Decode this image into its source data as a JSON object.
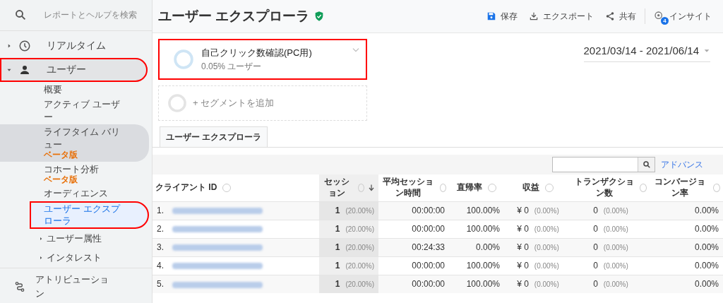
{
  "sidebar": {
    "search": {
      "placeholder": "レポートとヘルプを検索"
    },
    "nav": [
      {
        "kind": "clock",
        "label": "リアルタイム",
        "expanded": false,
        "annotated": false
      },
      {
        "kind": "person",
        "label": "ユーザー",
        "expanded": true,
        "annotated": true,
        "children": [
          {
            "label": "概要",
            "selected": false,
            "hovered": false,
            "annotated": false,
            "collapsible": false
          },
          {
            "label": "アクティブ ユーザー",
            "selected": false,
            "hovered": false,
            "annotated": false,
            "collapsible": false
          },
          {
            "label": "ライフタイム バリュー",
            "badge": "ベータ版",
            "selected": false,
            "hovered": true,
            "annotated": false,
            "collapsible": false
          },
          {
            "label": "コホート分析",
            "badge": "ベータ版",
            "selected": false,
            "hovered": false,
            "annotated": false,
            "collapsible": false
          },
          {
            "label": "オーディエンス",
            "selected": false,
            "hovered": false,
            "annotated": false,
            "collapsible": false
          },
          {
            "label": "ユーザー エクスプローラ",
            "selected": true,
            "hovered": false,
            "annotated": true,
            "collapsible": false
          },
          {
            "label": "ユーザー属性",
            "selected": false,
            "hovered": false,
            "annotated": false,
            "collapsible": true
          },
          {
            "label": "インタレスト",
            "selected": false,
            "hovered": false,
            "annotated": false,
            "collapsible": true
          }
        ]
      }
    ],
    "bottom": {
      "label": "アトリビューション"
    }
  },
  "header": {
    "title": "ユーザー エクスプローラ",
    "verified": true,
    "actions": [
      {
        "kind": "save",
        "label": "保存"
      },
      {
        "kind": "export",
        "label": "エクスポート"
      },
      {
        "kind": "share",
        "label": "共有"
      },
      {
        "kind": "insight",
        "label": "インサイト",
        "badge": "4"
      }
    ]
  },
  "segment": {
    "name": "自己クリック数確認(PC用)",
    "detail": "0.05% ユーザー",
    "annotated": true
  },
  "add_segment": "+ セグメントを追加",
  "date_range": "2021/03/14 - 2021/06/14",
  "tabs": [
    {
      "label": "ユーザー エクスプローラ",
      "selected": true
    }
  ],
  "table": {
    "advanced_link": "アドバンス",
    "columns": [
      {
        "label": "クライアント ID",
        "sorted": false
      },
      {
        "label": "セッション",
        "sorted": true
      },
      {
        "label": "平均セッション時間",
        "sorted": false
      },
      {
        "label": "直帰率",
        "sorted": false
      },
      {
        "label": "収益",
        "sorted": false
      },
      {
        "label": "トランザクション数",
        "sorted": false
      },
      {
        "label": "コンバージョン率",
        "sorted": false
      }
    ],
    "rows": [
      {
        "index": "1.",
        "sessions": "1",
        "sessions_pct": "(20.00%)",
        "avg_time": "00:00:00",
        "bounce": "100.00%",
        "revenue": "¥ 0",
        "revenue_pct": "(0.00%)",
        "transactions": "0",
        "transactions_pct": "(0.00%)",
        "conversion": "0.00%"
      },
      {
        "index": "2.",
        "sessions": "1",
        "sessions_pct": "(20.00%)",
        "avg_time": "00:00:00",
        "bounce": "100.00%",
        "revenue": "¥ 0",
        "revenue_pct": "(0.00%)",
        "transactions": "0",
        "transactions_pct": "(0.00%)",
        "conversion": "0.00%"
      },
      {
        "index": "3.",
        "sessions": "1",
        "sessions_pct": "(20.00%)",
        "avg_time": "00:24:33",
        "bounce": "0.00%",
        "revenue": "¥ 0",
        "revenue_pct": "(0.00%)",
        "transactions": "0",
        "transactions_pct": "(0.00%)",
        "conversion": "0.00%"
      },
      {
        "index": "4.",
        "sessions": "1",
        "sessions_pct": "(20.00%)",
        "avg_time": "00:00:00",
        "bounce": "100.00%",
        "revenue": "¥ 0",
        "revenue_pct": "(0.00%)",
        "transactions": "0",
        "transactions_pct": "(0.00%)",
        "conversion": "0.00%"
      },
      {
        "index": "5.",
        "sessions": "1",
        "sessions_pct": "(20.00%)",
        "avg_time": "00:00:00",
        "bounce": "100.00%",
        "revenue": "¥ 0",
        "revenue_pct": "(0.00%)",
        "transactions": "0",
        "transactions_pct": "(0.00%)",
        "conversion": "0.00%"
      }
    ]
  }
}
